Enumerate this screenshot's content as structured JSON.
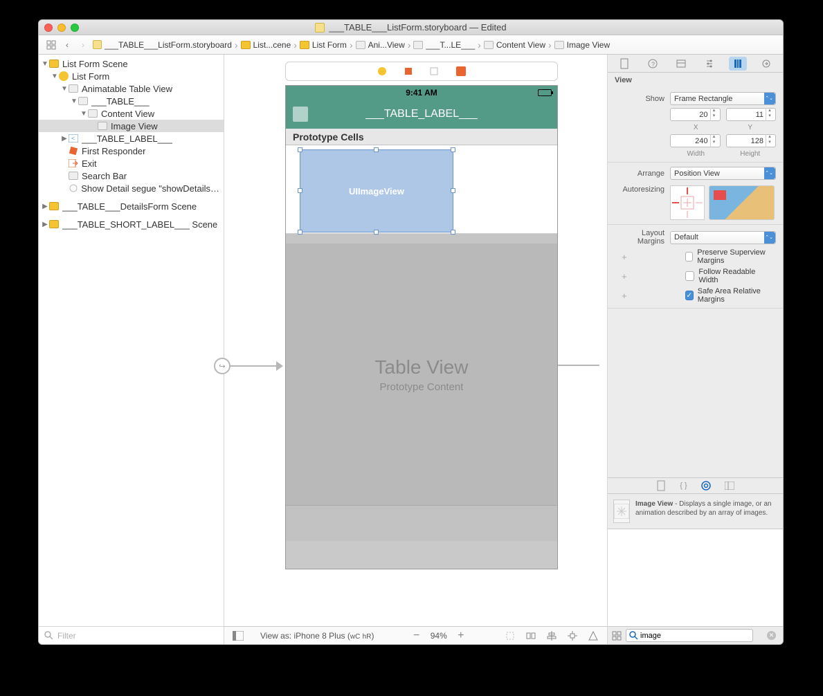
{
  "title": "___TABLE___ListForm.storyboard — Edited",
  "breadcrumb": [
    "___TABLE___ListForm.storyboard",
    "List...cene",
    "List Form",
    "Ani...View",
    "___T...LE___",
    "Content View",
    "Image View"
  ],
  "outline": {
    "scene1": "List Form Scene",
    "listForm": "List Form",
    "animTable": "Animatable Table View",
    "table": "___TABLE___",
    "contentView": "Content View",
    "imageView": "Image View",
    "tableLabel": "___TABLE_LABEL___",
    "firstResponder": "First Responder",
    "exit": "Exit",
    "searchBar": "Search Bar",
    "segue": "Show Detail segue \"showDetails\" t...",
    "scene2": "___TABLE___DetailsForm Scene",
    "scene3": "___TABLE_SHORT_LABEL___ Scene"
  },
  "filterPlaceholder": "Filter",
  "canvas": {
    "time": "9:41 AM",
    "navTitle": "___TABLE_LABEL___",
    "protoHeader": "Prototype Cells",
    "selLabel": "UIImageView",
    "tvTitle": "Table View",
    "tvSub": "Prototype Content"
  },
  "bottom": {
    "viewAs": "View as: iPhone 8 Plus (",
    "wc": "wC",
    "hr": "hR",
    "close": ")",
    "zoom": "94%"
  },
  "inspector": {
    "header": "View",
    "showLabel": "Show",
    "showValue": "Frame Rectangle",
    "x": "20",
    "y": "11",
    "xLabel": "X",
    "yLabel": "Y",
    "w": "240",
    "h": "128",
    "wLabel": "Width",
    "hLabel": "Height",
    "arrangeLabel": "Arrange",
    "arrangeValue": "Position View",
    "autosizeLabel": "Autoresizing",
    "marginsLabel": "Layout Margins",
    "marginsValue": "Default",
    "cb1": "Preserve Superview Margins",
    "cb2": "Follow Readable Width",
    "cb3": "Safe Area Relative Margins"
  },
  "library": {
    "title": "Image View",
    "desc": " - Displays a single image, or an animation described by an array of images.",
    "search": "image"
  }
}
